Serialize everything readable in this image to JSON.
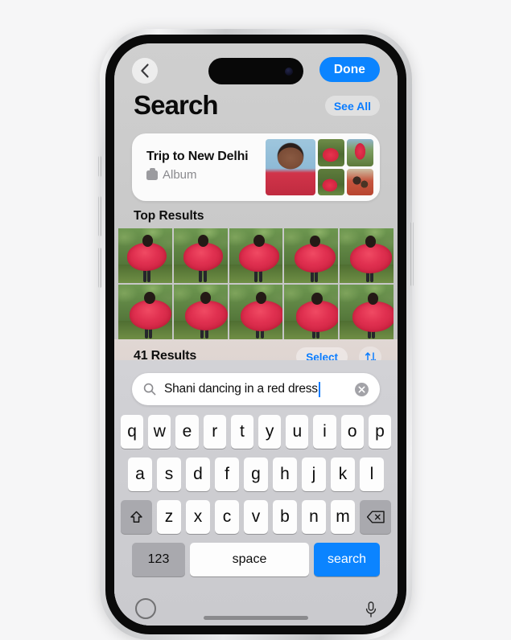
{
  "device": {
    "name": "iPhone",
    "island_label": "dynamic-island"
  },
  "topbar": {
    "back_label": "Back",
    "done_label": "Done"
  },
  "header": {
    "title": "Search",
    "see_all_label": "See All"
  },
  "album_card": {
    "title": "Trip to New Delhi",
    "subtitle": "Album",
    "icon": "album-icon",
    "thumbnails": [
      {
        "name": "portrait-girl-red-top"
      },
      {
        "name": "girl-twirling-red-dress"
      },
      {
        "name": "girl-on-red-chair"
      },
      {
        "name": "girl-dancing-garden"
      },
      {
        "name": "girl-hugging-boy"
      }
    ]
  },
  "sections": {
    "top_results_title": "Top Results"
  },
  "results_bar": {
    "count_label": "41 Results",
    "select_label": "Select",
    "sort_icon": "sort-arrows-icon"
  },
  "search": {
    "value": "Shani dancing in a red dress",
    "placeholder": "Search",
    "search_icon": "search-icon",
    "clear_icon": "clear-circle-icon",
    "caret_visible": true
  },
  "keyboard": {
    "row1": [
      "q",
      "w",
      "e",
      "r",
      "t",
      "y",
      "u",
      "i",
      "o",
      "p"
    ],
    "row2": [
      "a",
      "s",
      "d",
      "f",
      "g",
      "h",
      "j",
      "k",
      "l"
    ],
    "row3": [
      "z",
      "x",
      "c",
      "v",
      "b",
      "n",
      "m"
    ],
    "shift_label": "shift-icon",
    "delete_label": "delete-icon",
    "numbers_label": "123",
    "space_label": "space",
    "return_label": "search",
    "globe_label": "globe-icon",
    "dictate_label": "microphone-icon"
  },
  "colors": {
    "accent_blue": "#0b84ff",
    "link_blue": "#0a7cff",
    "page_background": "#f6f6f7",
    "app_background": "#c7c7c7",
    "key_face": "#fdfdfd",
    "key_fn": "#a9a9ae",
    "results_bar": "#e2d8d4"
  },
  "grid_photos": [
    {
      "name": "dancer-photo-1"
    },
    {
      "name": "dancer-photo-2"
    },
    {
      "name": "dancer-photo-3"
    },
    {
      "name": "dancer-photo-4"
    },
    {
      "name": "dancer-photo-5"
    },
    {
      "name": "dancer-photo-6"
    },
    {
      "name": "dancer-photo-7"
    },
    {
      "name": "dancer-photo-8"
    },
    {
      "name": "dancer-photo-9"
    },
    {
      "name": "dancer-photo-10"
    }
  ]
}
